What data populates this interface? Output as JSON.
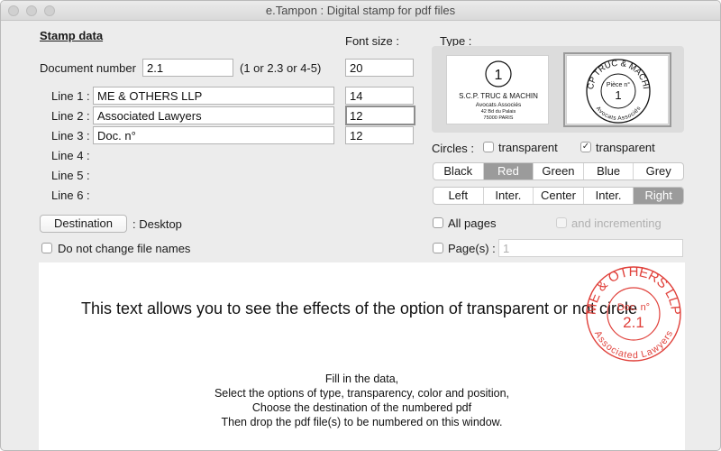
{
  "window": {
    "title": "e.Tampon : Digital stamp for pdf files"
  },
  "stamp_data": {
    "heading": "Stamp data",
    "font_size_label": "Font size :",
    "document_number_label": "Document number",
    "document_number_value": "2.1",
    "document_number_hint": "(1 or 2.3 or 4-5)",
    "document_number_font_size": "20",
    "lines": [
      {
        "label": "Line 1 :",
        "value": "ME & OTHERS LLP",
        "font_size": "14"
      },
      {
        "label": "Line 2 :",
        "value": "Associated Lawyers",
        "font_size": "12"
      },
      {
        "label": "Line 3 :",
        "value": "Doc. n°",
        "font_size": "12"
      },
      {
        "label": "Line 4 :"
      },
      {
        "label": "Line 5 :"
      },
      {
        "label": "Line 6 :"
      }
    ],
    "destination_button": "Destination",
    "destination_value": ": Desktop",
    "do_not_change_label": "Do not change file names",
    "do_not_change_checked": false
  },
  "type": {
    "label": "Type :",
    "rect_stamp": {
      "number": "1",
      "line1": "S.C.P. TRUC & MACHIN",
      "line2": "Avocats Associés",
      "line3": "42 Bd du Palais",
      "line4": "75000 PARIS"
    },
    "round_stamp": {
      "arc_top": "SCP TRUC & MACHIN",
      "arc_bottom": "Avocats Associés",
      "center_label": "Pièce n°",
      "number": "1"
    }
  },
  "circles": {
    "label": "Circles :",
    "option1": {
      "label": "transparent",
      "checked": false
    },
    "option2": {
      "label": "transparent",
      "checked": true
    }
  },
  "colors": {
    "options": [
      "Black",
      "Red",
      "Green",
      "Blue",
      "Grey"
    ],
    "selected": "Red"
  },
  "positions": {
    "options": [
      "Left",
      "Inter.",
      "Center",
      "Inter.",
      "Right"
    ],
    "selected_index": 4
  },
  "pages": {
    "all_pages_label": "All pages",
    "all_pages_checked": false,
    "incrementing_label": "and incrementing",
    "pages_label": "Page(s) :",
    "pages_checked": false,
    "pages_value": "1"
  },
  "preview": {
    "sample_text": "This text allows you to see the effects of the option of transparent or not circle",
    "instructions": [
      "Fill in the data,",
      "Select the options of type, transparency, color and position,",
      "Choose the destination of the numbered pdf",
      "Then drop the pdf file(s) to be numbered on this window."
    ],
    "stamp": {
      "arc_top": "ME & OTHERS LLP",
      "arc_bottom": "Associated Lawyers",
      "center_label": "Doc. n°",
      "number": "2.1"
    }
  },
  "colors_palette": {
    "stamp_red": "#e0403a",
    "selected_segment": "#9b9b9b"
  }
}
